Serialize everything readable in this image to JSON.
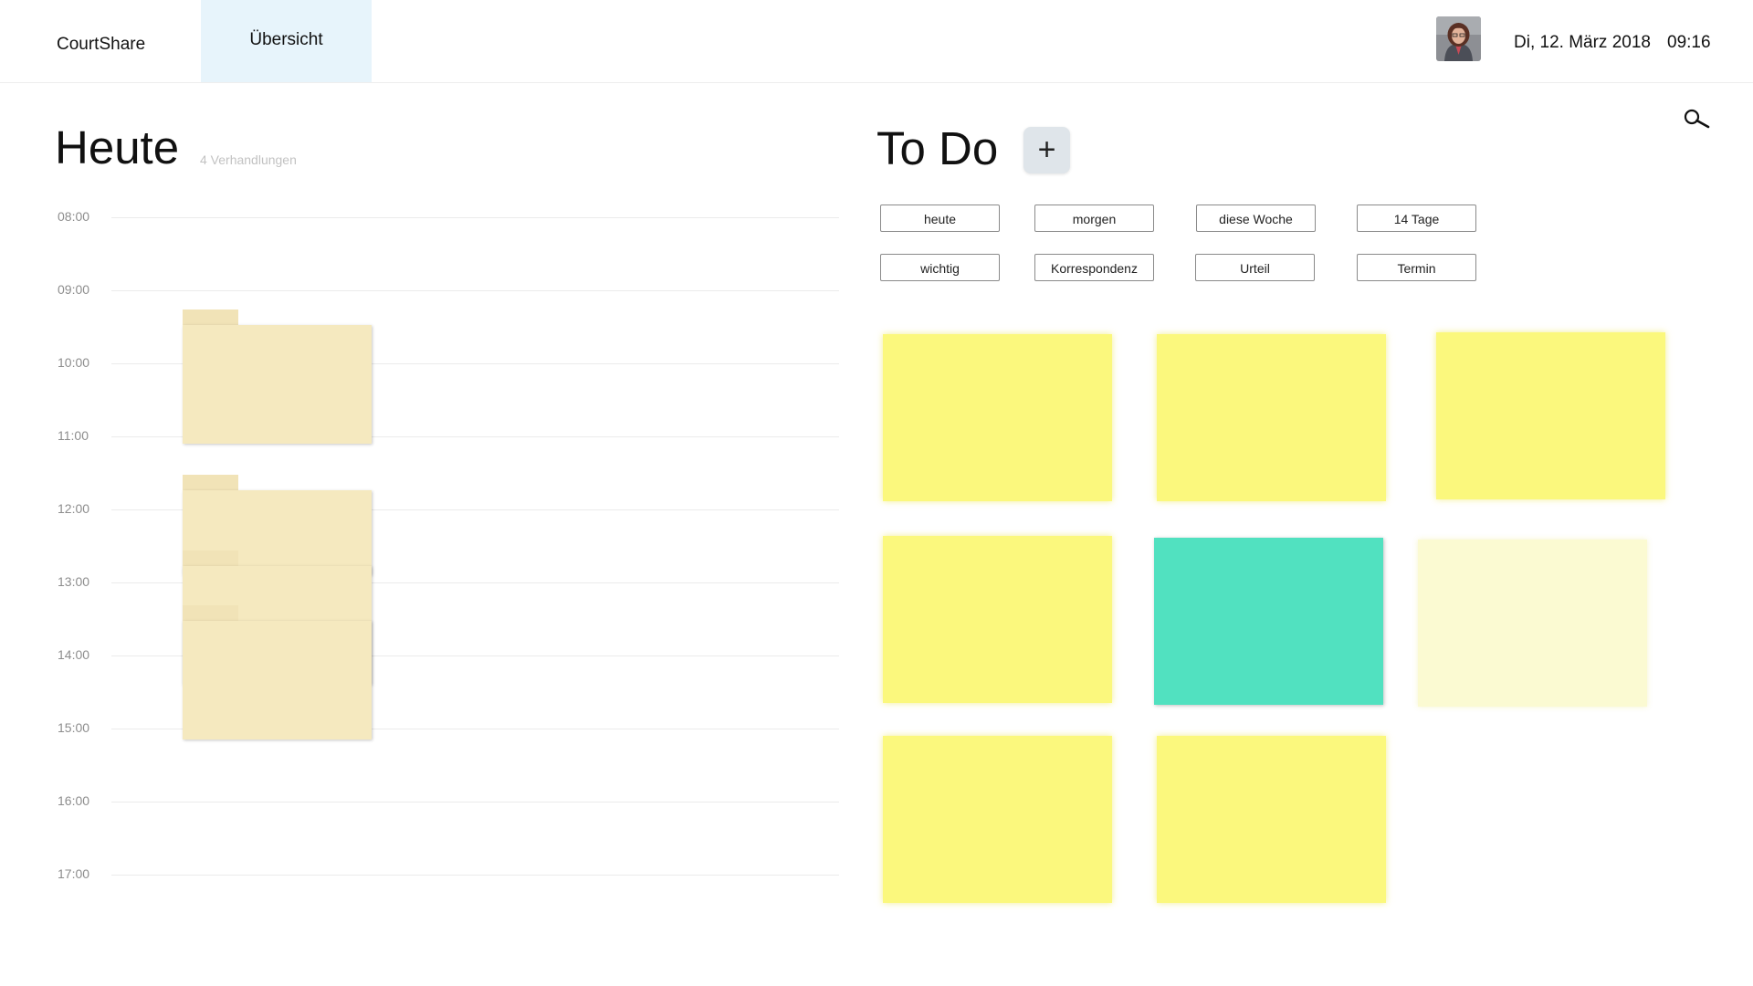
{
  "app": {
    "name": "CourtShare"
  },
  "nav": {
    "tabs": [
      {
        "label": "Übersicht",
        "active": true
      }
    ]
  },
  "header": {
    "date": "Di, 12. März 2018",
    "time": "09:16",
    "avatar_icon": "user-avatar"
  },
  "today": {
    "title": "Heute",
    "count_label": "4 Verhandlungen",
    "hours": [
      "08:00",
      "09:00",
      "10:00",
      "11:00",
      "12:00",
      "13:00",
      "14:00",
      "15:00",
      "16:00",
      "17:00"
    ],
    "folder_color": "#f5e9bf"
  },
  "todo": {
    "title": "To Do",
    "add_label": "+",
    "search_icon": "search-icon",
    "filters_row1": [
      "heute",
      "morgen",
      "diese Woche",
      "14 Tage"
    ],
    "filters_row2": [
      "wichtig",
      "Korrespondenz",
      "Urteil",
      "Termin"
    ],
    "note_colors": {
      "yellow": "#fbf87d",
      "teal": "#51e1c0",
      "pale": "#fbfad2"
    }
  }
}
